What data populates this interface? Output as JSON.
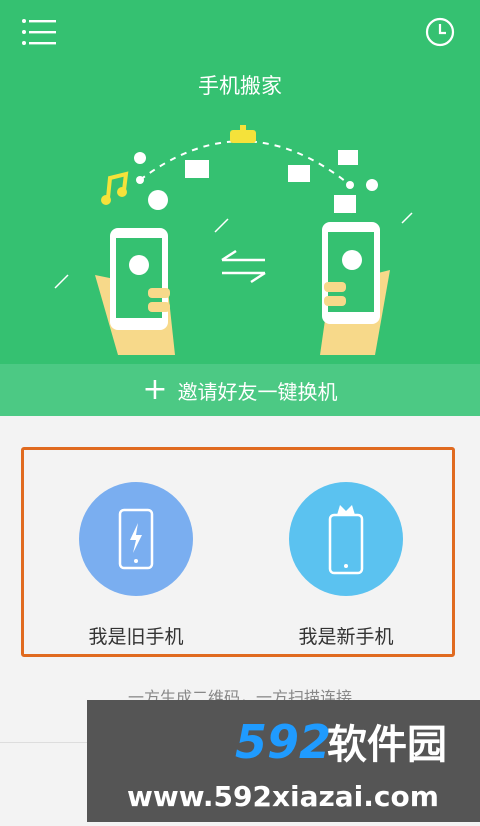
{
  "header": {
    "title": "手机搬家",
    "menu_icon": "hamburger-menu-icon",
    "history_icon": "clock-icon"
  },
  "invite": {
    "plus": "+",
    "label": "邀请好友一键换机"
  },
  "roles": {
    "old": {
      "label": "我是旧手机",
      "icon": "phone-bolt-icon"
    },
    "new": {
      "label": "我是新手机",
      "icon": "phone-crown-icon"
    }
  },
  "hint": "一方生成二维码，一方扫描连接",
  "watermark": {
    "line1": "592软件园",
    "line2": "www.592xiazai.com"
  },
  "colors": {
    "brand_green": "#35c171",
    "invite_green": "#4cc984",
    "old_circle": "#7aaef0",
    "new_circle": "#5bc2f0",
    "highlight_border": "#e06a1f"
  }
}
